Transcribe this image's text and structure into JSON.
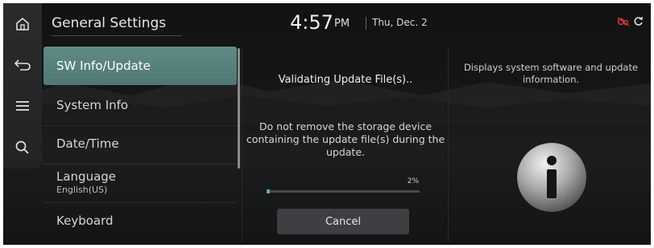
{
  "header": {
    "title": "General Settings",
    "time": "4:57",
    "ampm": "PM",
    "date": "Thu, Dec. 2"
  },
  "rail": {
    "items": [
      {
        "icon": "home-icon"
      },
      {
        "icon": "back-icon"
      },
      {
        "icon": "menu-icon"
      },
      {
        "icon": "search-icon"
      }
    ]
  },
  "menu": {
    "items": [
      {
        "label": "SW Info/Update",
        "active": true
      },
      {
        "label": "System Info",
        "active": false
      },
      {
        "label": "Date/Time",
        "active": false
      },
      {
        "label": "Language",
        "value": "English(US)",
        "active": false
      },
      {
        "label": "Keyboard",
        "active": false
      }
    ]
  },
  "update": {
    "status": "Validating Update File(s)..",
    "warning": "Do not remove the storage device containing the update file(s) during the update.",
    "progress_label": "2%",
    "progress": 0.02,
    "cancel_label": "Cancel"
  },
  "info": {
    "description": "Displays system software and update information.",
    "icon": "info-icon"
  },
  "status_icons": [
    "connectivity-off-icon",
    "refresh-icon"
  ],
  "colors": {
    "accent": "#5f8b87",
    "progress": "#5aa6c8",
    "status_warn": "#d23a3a"
  }
}
